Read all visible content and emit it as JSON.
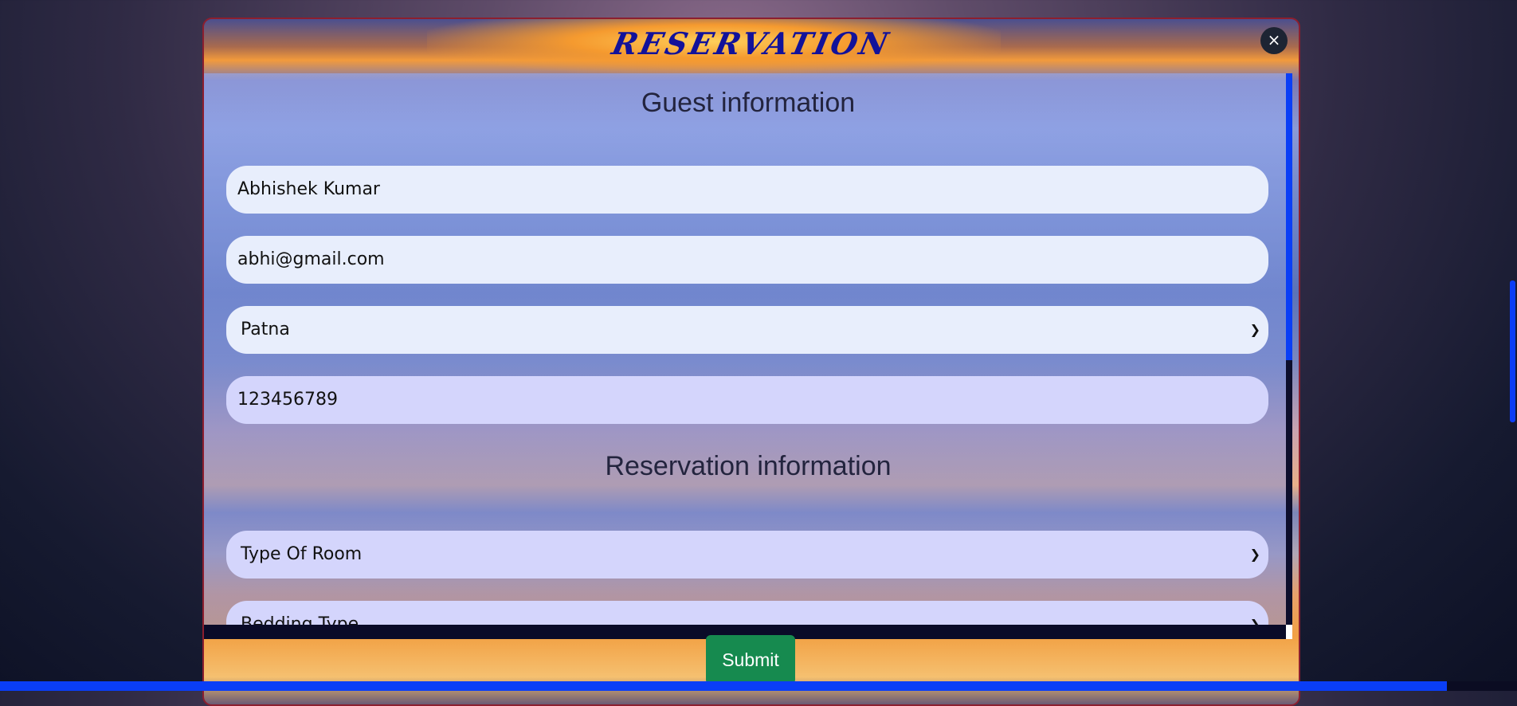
{
  "modal": {
    "title": "RESERVATION",
    "close_glyph": "×"
  },
  "guest_section": {
    "title": "Guest information",
    "name_value": "Abhishek Kumar",
    "email_value": "abhi@gmail.com",
    "city_selected": "Patna",
    "phone_value": "123456789"
  },
  "reservation_section": {
    "title": "Reservation information",
    "room_type_selected": "Type Of Room",
    "bedding_type_selected": "Bedding Type"
  },
  "actions": {
    "submit_label": "Submit"
  },
  "icons": {
    "close": "close-icon",
    "dropdown": "chevron-down-icon"
  },
  "colors": {
    "title": "#12129a",
    "submit": "#168a4f",
    "scroll_accent": "#0a3ef6",
    "modal_border": "#8c1f2f"
  }
}
